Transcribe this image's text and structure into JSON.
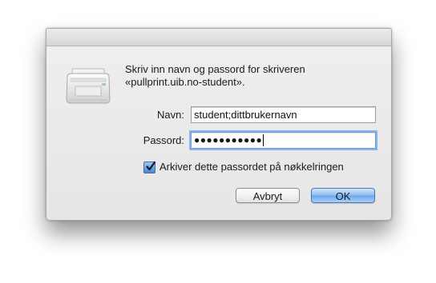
{
  "dialog": {
    "message_line1": "Skriv inn navn og passord for skriveren",
    "message_line2": "«pullprint.uib.no-student».",
    "icon": "printer-icon"
  },
  "fields": {
    "name_label": "Navn:",
    "name_value": "student;dittbrukernavn",
    "password_label": "Passord:",
    "password_masked": "●●●●●●●●●●●"
  },
  "checkbox": {
    "label": "Arkiver dette passordet på nøkkelringen",
    "checked": true
  },
  "buttons": {
    "cancel": "Avbryt",
    "ok": "OK"
  },
  "colors": {
    "accent": "#6aa4ea",
    "focus_ring": "#8ab4ea"
  }
}
